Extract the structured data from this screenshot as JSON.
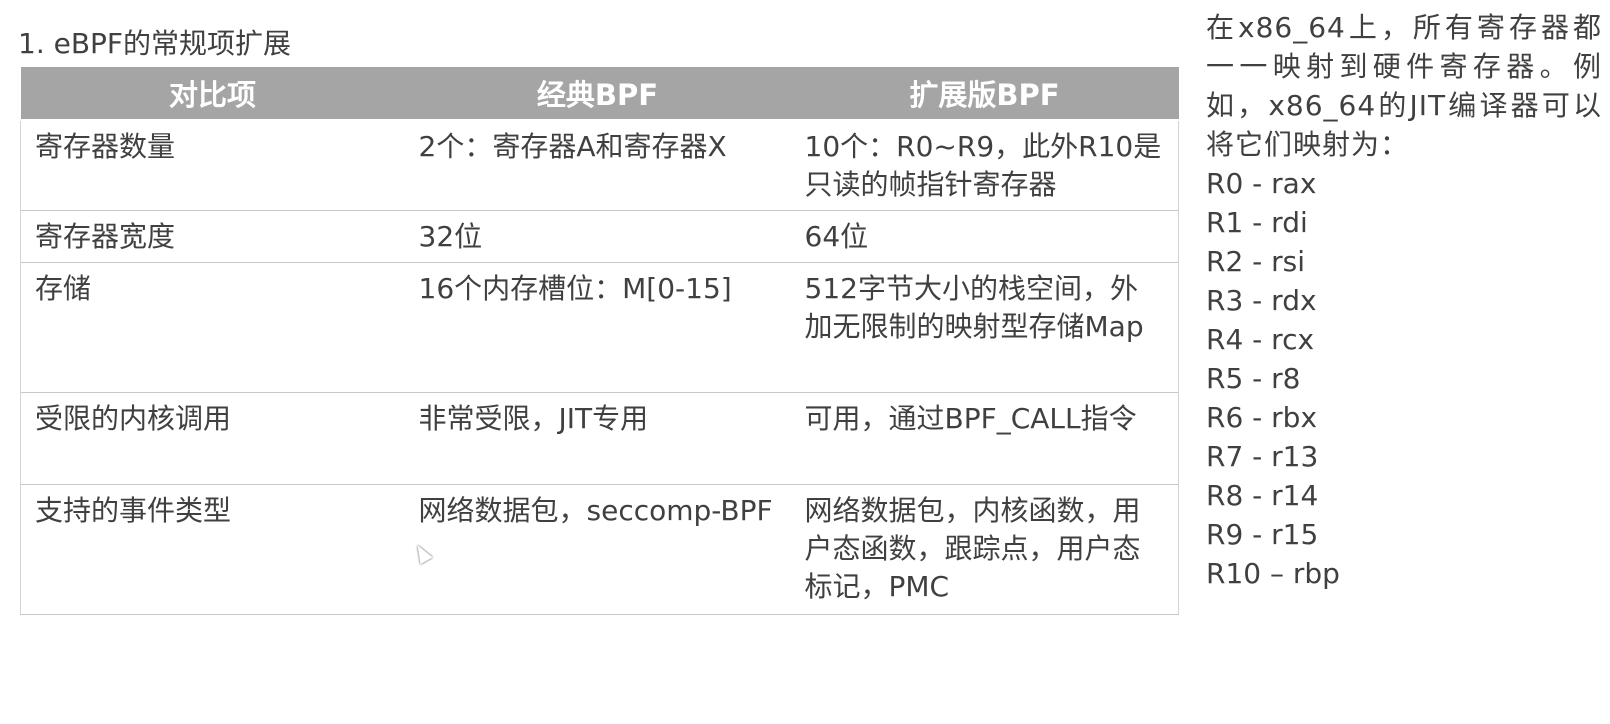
{
  "title": "1. eBPF的常规项扩展",
  "table": {
    "headers": [
      "对比项",
      "经典BPF",
      "扩展版BPF"
    ],
    "rows": [
      {
        "item": "寄存器数量",
        "classic": "2个：寄存器A和寄存器X",
        "extended": "10个：R0~R9，此外R10是只读的帧指针寄存器"
      },
      {
        "item": "寄存器宽度",
        "classic": "32位",
        "extended": "64位"
      },
      {
        "item": "存储",
        "classic": "16个内存槽位：M[0-15]",
        "extended": "512字节大小的栈空间，外加无限制的映射型存储Map"
      },
      {
        "item": "受限的内核调用",
        "classic": "非常受限，JIT专用",
        "extended": "可用，通过BPF_CALL指令"
      },
      {
        "item": "支持的事件类型",
        "classic": "网络数据包，seccomp-BPF",
        "extended": "网络数据包，内核函数，用户态函数，跟踪点，用户态标记，PMC"
      }
    ]
  },
  "side_note": {
    "text": "在x86_64上，所有寄存器都一一映射到硬件寄存器。例如，x86_64的JIT编译器可以将它们映射为：",
    "mappings": [
      "R0 - rax",
      "R1 - rdi",
      "R2 - rsi",
      "R3 - rdx",
      "R4 - rcx",
      "R5 - r8",
      "R6 - rbx",
      "R7 - r13",
      "R8 - r14",
      "R9 - r15",
      "R10 – rbp"
    ]
  },
  "colors": {
    "header_bg": "#a5a5a5",
    "header_text": "#ffffff",
    "body_text": "#404040",
    "border": "#c8c8c8"
  },
  "icons": {
    "cursor": "mouse-pointer-icon"
  }
}
